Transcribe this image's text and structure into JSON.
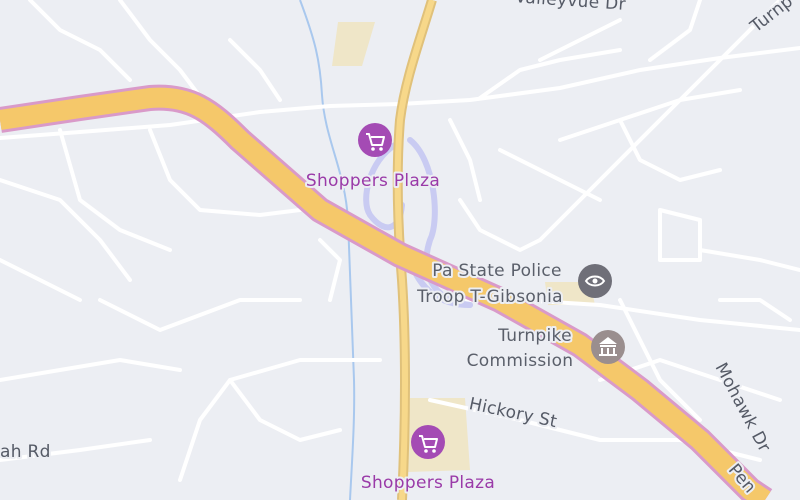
{
  "map": {
    "background_color": "#eceef3",
    "highway_color": "#f5c86a",
    "highway_border_color": "#d99ac9",
    "road_color": "#ffffff",
    "water_color": "#a9c8ee",
    "ramp_color": "#c9cbf2",
    "commercial_area_color": "#efe6c8"
  },
  "pois": [
    {
      "id": "shoppers-plaza-north",
      "label": "Shoppers Plaza",
      "icon": "shopping-cart-icon",
      "color": "#a44bb4"
    },
    {
      "id": "shoppers-plaza-south",
      "label": "Shoppers Plaza",
      "icon": "shopping-cart-icon",
      "color": "#a44bb4"
    },
    {
      "id": "state-police",
      "label_line1": "Pa State Police",
      "label_line2": "Troop T-Gibsonia",
      "icon": "police-badge-icon",
      "color": "#6f6f78"
    },
    {
      "id": "turnpike-commission",
      "label_line1": "Turnpike",
      "label_line2": "Commission",
      "icon": "government-building-icon",
      "color": "#9a8e8e"
    }
  ],
  "street_labels": {
    "valleyvue": "Valleyvue Dr",
    "turnpike_top": "Turnp",
    "hickory": "Hickory St",
    "mohawk": "Mohawk Dr",
    "ah_rd": "ah Rd",
    "penn": "Pen"
  }
}
